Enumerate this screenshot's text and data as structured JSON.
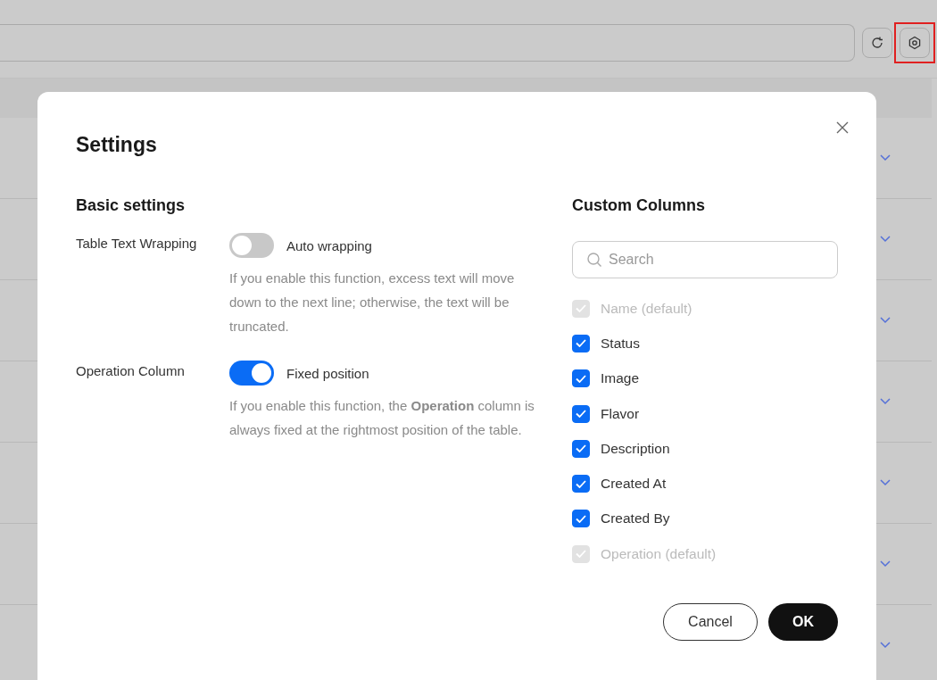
{
  "toolbar": {
    "buttons": [
      {
        "kind": "refresh",
        "highlighted": false
      },
      {
        "kind": "settings",
        "highlighted": true
      }
    ]
  },
  "dialog": {
    "title": "Settings",
    "basic_settings": {
      "heading": "Basic settings",
      "items": [
        {
          "label": "Table Text Wrapping",
          "switch_label": "Auto wrapping",
          "on": false,
          "description": "If you enable this function, excess text will move down to the next line; otherwise, the text will be truncated."
        },
        {
          "label": "Operation Column",
          "switch_label": "Fixed position",
          "on": true,
          "description": "If you enable this function, the **Operation** column is always fixed at the rightmost position of the table."
        }
      ]
    },
    "custom_columns": {
      "heading": "Custom Columns",
      "search": {
        "placeholder": "Search"
      },
      "items": [
        {
          "label": "Name (default)",
          "checked": true,
          "disabled": true
        },
        {
          "label": "Status",
          "checked": true,
          "disabled": false
        },
        {
          "label": "Image",
          "checked": true,
          "disabled": false
        },
        {
          "label": "Flavor",
          "checked": true,
          "disabled": false
        },
        {
          "label": "Description",
          "checked": true,
          "disabled": false
        },
        {
          "label": "Created At",
          "checked": true,
          "disabled": false
        },
        {
          "label": "Created By",
          "checked": true,
          "disabled": false
        },
        {
          "label": "Operation (default)",
          "checked": true,
          "disabled": true
        }
      ]
    },
    "buttons": [
      {
        "label": "Cancel",
        "kind": "secondary"
      },
      {
        "label": "OK",
        "kind": "primary"
      }
    ]
  }
}
